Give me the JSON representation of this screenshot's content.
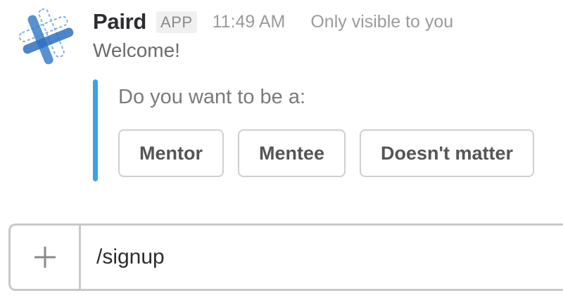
{
  "message": {
    "sender": "Paird",
    "badge": "APP",
    "timestamp": "11:49 AM",
    "visibility": "Only visible to you",
    "text": "Welcome!",
    "avatar_icon": "paird-logo-icon"
  },
  "attachment": {
    "accent_color": "#3aa3e3",
    "prompt": "Do you want to be a:",
    "buttons": [
      {
        "label": "Mentor"
      },
      {
        "label": "Mentee"
      },
      {
        "label": "Doesn't matter"
      }
    ]
  },
  "composer": {
    "plus_icon": "plus-icon",
    "value": "/signup"
  }
}
